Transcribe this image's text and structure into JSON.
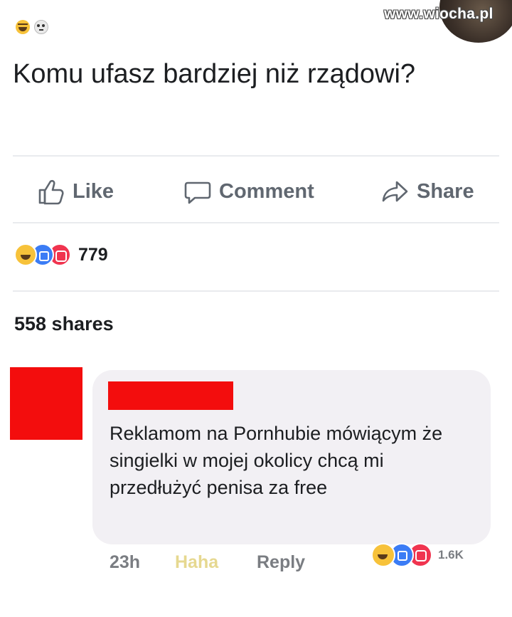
{
  "header": {
    "emoji_icons": [
      "laughing-face-icon",
      "skull-icon"
    ],
    "watermark": "www.wiocha.pl"
  },
  "post": {
    "title": "Komu ufasz bardziej niż rządowi?",
    "actions": {
      "like": "Like",
      "comment": "Comment",
      "share": "Share"
    },
    "reactions": {
      "icons": [
        "haha-reaction-icon",
        "like-reaction-icon",
        "love-reaction-icon"
      ],
      "count": "779"
    },
    "shares": "558 shares"
  },
  "comment": {
    "text": "Reklamom na Pornhubie mówiącym że singielki w mojej okolicy chcą mi przedłużyć penisa za free",
    "time": "23h",
    "reaction_label": "Haha",
    "reply_label": "Reply",
    "reaction_count": "1.6K"
  },
  "colors": {
    "redaction": "#f30d0d",
    "bubble": "#f2f0f4",
    "action_text": "#606770"
  }
}
